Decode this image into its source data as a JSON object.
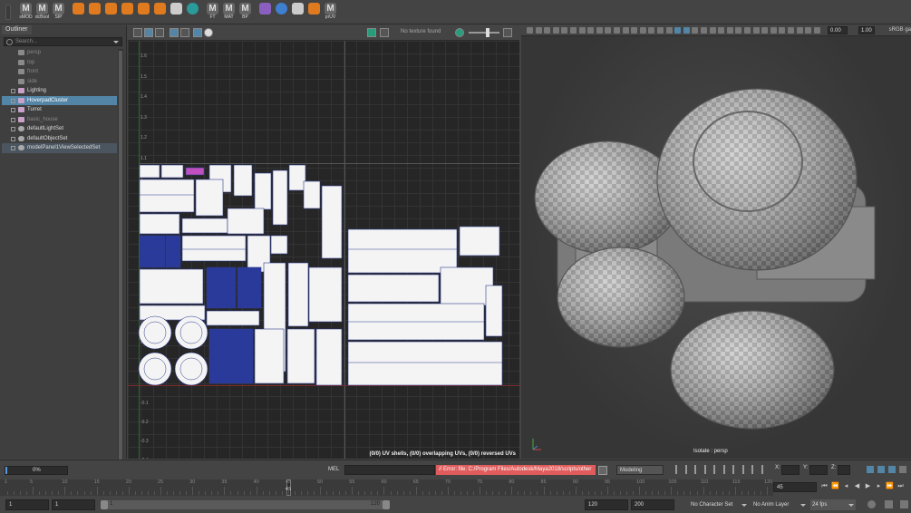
{
  "shelf": {
    "buttons": [
      {
        "icon": "m-icon",
        "label": "sMOD"
      },
      {
        "icon": "m-icon",
        "label": "dcBool"
      },
      {
        "icon": "m-icon",
        "label": "SIP"
      },
      {
        "icon": "cube-icon",
        "label": ""
      },
      {
        "icon": "poly-sphere-icon",
        "label": ""
      },
      {
        "icon": "poly-cylinder-icon",
        "label": ""
      },
      {
        "icon": "poly-cone-icon",
        "label": ""
      },
      {
        "icon": "poly-torus-icon",
        "label": ""
      },
      {
        "icon": "poly-plane-icon",
        "label": ""
      },
      {
        "icon": "uv-grid-icon",
        "label": ""
      },
      {
        "icon": "teal-sphere-icon",
        "label": ""
      },
      {
        "icon": "m-icon",
        "label": "FT"
      },
      {
        "icon": "m-icon",
        "label": "MAT"
      },
      {
        "icon": "m-icon",
        "label": "BP"
      },
      {
        "icon": "curve-icon",
        "label": ""
      },
      {
        "icon": "globe-icon",
        "label": ""
      },
      {
        "icon": "tea-icon",
        "label": ""
      },
      {
        "icon": "bomb-icon",
        "label": ""
      },
      {
        "icon": "m-icon",
        "label": "prUV"
      }
    ]
  },
  "outliner": {
    "tab": "Outliner",
    "search_placeholder": "Search...",
    "items": [
      {
        "label": "persp",
        "type": "camera",
        "dim": true
      },
      {
        "label": "top",
        "type": "camera",
        "dim": true
      },
      {
        "label": "front",
        "type": "camera",
        "dim": true
      },
      {
        "label": "side",
        "type": "camera",
        "dim": true
      },
      {
        "label": "Lighting",
        "type": "group",
        "dim": false
      },
      {
        "label": "HoverpadCluster",
        "type": "group",
        "dim": false,
        "selected": true
      },
      {
        "label": "Turret",
        "type": "group",
        "dim": false
      },
      {
        "label": "basic_house",
        "type": "group",
        "dim": true
      },
      {
        "label": "defaultLightSet",
        "type": "set",
        "dim": false
      },
      {
        "label": "defaultObjectSet",
        "type": "set",
        "dim": false
      },
      {
        "label": "modelPanel1ViewSelectedSet",
        "type": "set",
        "dim": false,
        "set_selected": true
      }
    ]
  },
  "uv_editor": {
    "no_texture": "No texture found",
    "status": "(0/0) UV shells, (0/0) overlapping UVs, (0/0) reversed UVs",
    "v_ticks_pos": [
      "1.6",
      "1.5",
      "1.4",
      "1.3",
      "1.2",
      "1.1",
      "1",
      "0.9",
      "0.8",
      "0.7",
      "0.6",
      "0.5",
      "0.4",
      "0.3",
      "0.2",
      "0.1"
    ],
    "v_ticks_neg": [
      "-0.1",
      "-0.2",
      "-0.3",
      "-0.4"
    ]
  },
  "viewport": {
    "exposure": "0.00",
    "gamma": "1.00",
    "colorspace": "sRGB ga",
    "isolate": "Isolate : persp"
  },
  "status_line": {
    "progress": "0%",
    "progress_fraction": 0.0,
    "mel_label": "MEL",
    "error": "// Error: file: C:/Program Files/Autodesk/Maya2018/scripts/other",
    "menu_set": "Modeling",
    "x_label": "X:",
    "y_label": "Y:",
    "z_label": "Z:"
  },
  "timeline": {
    "numbers": [
      "1",
      "5",
      "10",
      "15",
      "20",
      "25",
      "30",
      "35",
      "40",
      "45",
      "50",
      "55",
      "60",
      "65",
      "70",
      "75",
      "80",
      "85",
      "90",
      "95",
      "100",
      "105",
      "110",
      "115",
      "120"
    ],
    "current_frame_marker": "45",
    "current_frame": "45"
  },
  "range": {
    "start": "1",
    "start_anim": "1",
    "range_start": "1",
    "range_end": "120",
    "end": "120",
    "end_anim": "200",
    "character_set": "No Character Set",
    "anim_layer": "No Anim Layer",
    "fps": "24 fps"
  }
}
